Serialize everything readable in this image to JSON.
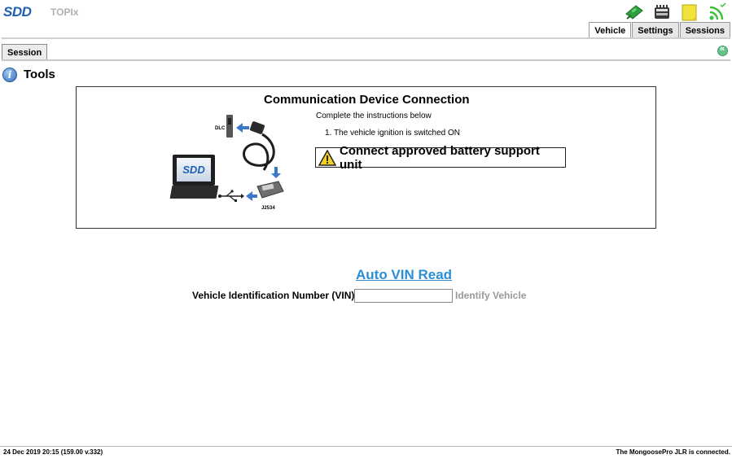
{
  "app": {
    "brand": "SDD",
    "subtitle": "TOPIx"
  },
  "header": {
    "icons": [
      "cable-icon",
      "memory-icon",
      "notes-icon",
      "signal-icon"
    ],
    "tabs": [
      {
        "label": "Vehicle",
        "active": true
      },
      {
        "label": "Settings",
        "active": false
      },
      {
        "label": "Sessions",
        "active": false
      }
    ]
  },
  "session": {
    "tab_label": "Session"
  },
  "page": {
    "title": "Tools"
  },
  "panel": {
    "title": "Communication Device Connection",
    "intro": "Complete the instructions below",
    "steps": [
      "1.  The vehicle ignition is switched ON"
    ],
    "warning": "Connect approved battery support unit",
    "diagram_labels": {
      "dlc": "DLC",
      "j2534": "J2534",
      "laptop_logo": "SDD"
    }
  },
  "vin": {
    "auto_read_label": "Auto VIN Read",
    "field_label": "Vehicle Identification Number (VIN):",
    "value": "",
    "identify_label": "Identify Vehicle"
  },
  "footer": {
    "left": "24 Dec 2019 20:15 (159.00 v.332)",
    "right": "The MongoosePro JLR is connected."
  },
  "colors": {
    "brand": "#1f5fb5",
    "link": "#2a8fd6",
    "disabled": "#999999",
    "arrow": "#3b78c9"
  }
}
